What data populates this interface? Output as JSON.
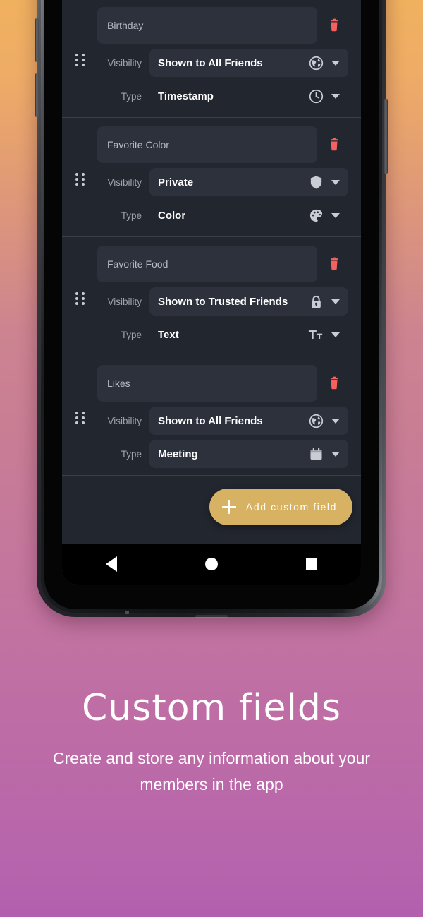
{
  "caption": {
    "headline": "Custom fields",
    "subhead": "Create and store any information about your members in the app"
  },
  "colors": {
    "accent_gold": "#d6b262",
    "delete_red": "#f5615e",
    "screen_bg": "#22262f",
    "card_bg": "#2c313c",
    "label_grey": "#9ea1aa",
    "value_white": "#ffffff"
  },
  "app": {
    "toolbar": {
      "sort_icon": "sort-arrows-icon",
      "view_compact_icon": "list-compact-icon",
      "view_detailed_icon": "list-detailed-icon",
      "view_detailed_selected": true
    },
    "labels": {
      "visibility": "Visibility",
      "type": "Type"
    },
    "fields": [
      {
        "name": "Birthday",
        "visibility": "Shown to All Friends",
        "visibility_icon": "globe-icon",
        "type": "Timestamp",
        "type_icon": "clock-icon"
      },
      {
        "name": "Favorite Color",
        "visibility": "Private",
        "visibility_icon": "shield-icon",
        "type": "Color",
        "type_icon": "palette-icon"
      },
      {
        "name": "Favorite Food",
        "visibility": "Shown to Trusted Friends",
        "visibility_icon": "lock-icon",
        "type": "Text",
        "type_icon": "text-format-icon"
      },
      {
        "name": "Likes",
        "visibility": "Shown to All Friends",
        "visibility_icon": "globe-icon",
        "type": "Meeting",
        "type_icon": "calendar-icon"
      }
    ],
    "fab": {
      "label": "Add custom field",
      "plus_icon": "plus-icon"
    },
    "nav_bar": {
      "back_icon": "back-triangle-icon",
      "home_icon": "home-circle-icon",
      "recents_icon": "recents-square-icon"
    }
  }
}
